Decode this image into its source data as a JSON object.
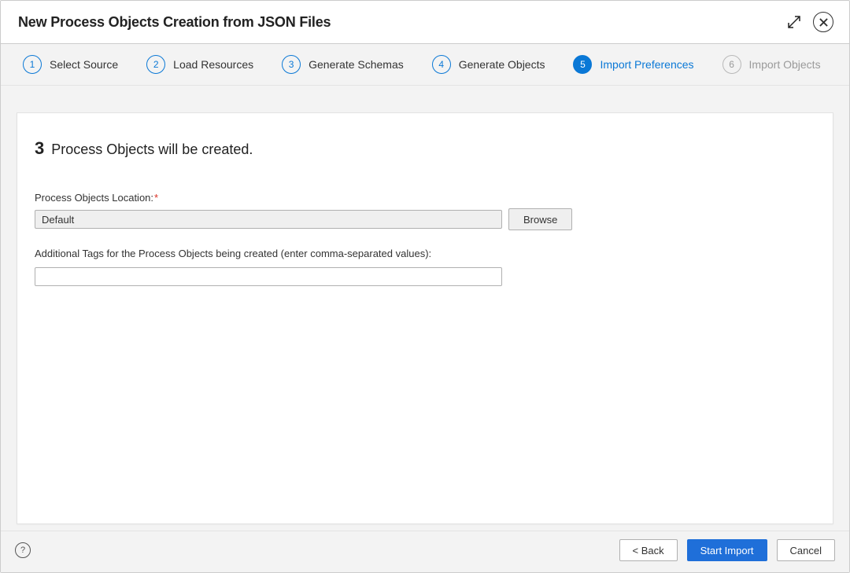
{
  "dialog": {
    "title": "New Process Objects Creation from JSON Files"
  },
  "wizard": {
    "steps": [
      {
        "num": "1",
        "label": "Select Source",
        "state": "done"
      },
      {
        "num": "2",
        "label": "Load Resources",
        "state": "done"
      },
      {
        "num": "3",
        "label": "Generate Schemas",
        "state": "done"
      },
      {
        "num": "4",
        "label": "Generate Objects",
        "state": "done"
      },
      {
        "num": "5",
        "label": "Import Preferences",
        "state": "active"
      },
      {
        "num": "6",
        "label": "Import Objects",
        "state": "disabled"
      }
    ]
  },
  "main": {
    "count": "3",
    "summary_text": "Process Objects will be created.",
    "location": {
      "label": "Process Objects Location:",
      "required_marker": "*",
      "value": "Default",
      "browse_label": "Browse"
    },
    "tags": {
      "label": "Additional Tags for the Process Objects being created (enter comma-separated values):",
      "value": ""
    }
  },
  "footer": {
    "help_symbol": "?",
    "back_label": "< Back",
    "start_label": "Start Import",
    "cancel_label": "Cancel"
  }
}
